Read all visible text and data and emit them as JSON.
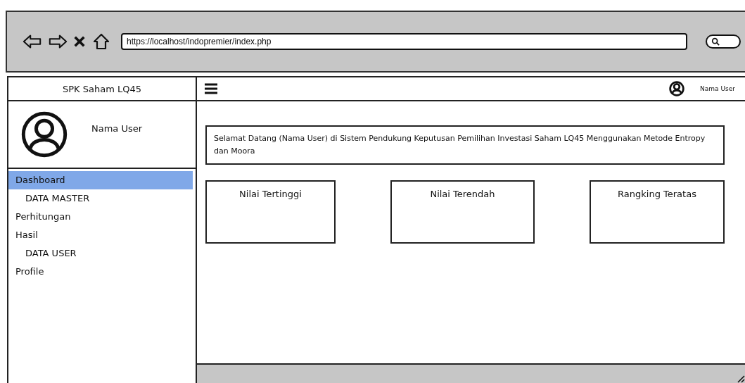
{
  "browser": {
    "url": "https://localhost/indopremier/index.php"
  },
  "sidebar": {
    "title": "SPK Saham LQ45",
    "user_name": "Nama User",
    "items": [
      {
        "label": "Dashboard",
        "kind": "item",
        "selected": true
      },
      {
        "label": "DATA MASTER",
        "kind": "section",
        "selected": false
      },
      {
        "label": "Perhitungan",
        "kind": "item",
        "selected": false
      },
      {
        "label": "Hasil",
        "kind": "item",
        "selected": false
      },
      {
        "label": "DATA USER",
        "kind": "section",
        "selected": false
      },
      {
        "label": "Profile",
        "kind": "item",
        "selected": false
      }
    ]
  },
  "topbar": {
    "user_name": "Nama User"
  },
  "welcome": "Selamat Datang (Nama User) di Sistem Pendukung Keputusan Pemilihan Investasi Saham LQ45 Menggunakan Metode Entropy dan Moora",
  "cards": [
    {
      "title": "Nilai Tertinggi"
    },
    {
      "title": "Nilai Terendah"
    },
    {
      "title": "Rangking Teratas"
    }
  ]
}
